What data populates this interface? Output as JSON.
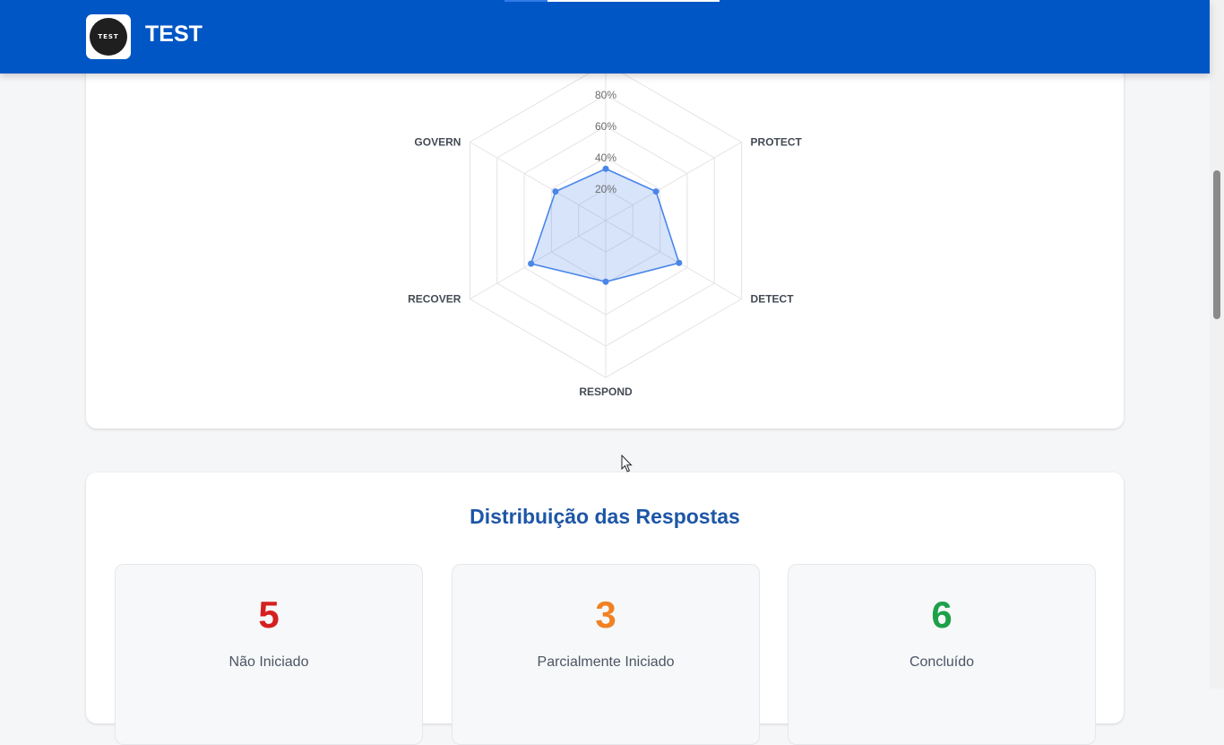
{
  "header": {
    "logo_text": "TEST",
    "title": "TEST",
    "background_color": "#0056c5"
  },
  "radar_chart": {
    "chart_data": {
      "type": "radar",
      "axes": [
        "GOVERN",
        "PROTECT",
        "DETECT",
        "RESPOND",
        "RECOVER"
      ],
      "series": [
        {
          "values": [
            33,
            37,
            54,
            39,
            55,
            37
          ]
        }
      ],
      "axis_order_clockwise_from_top": [
        "(unlabeled top)",
        "PROTECT",
        "DETECT",
        "RESPOND",
        "RECOVER",
        "GOVERN"
      ],
      "tick_labels": [
        "20%",
        "40%",
        "60%",
        "80%"
      ],
      "rmax": 100,
      "line_color": "#4a86e8",
      "fill_color": "rgba(74,134,232,0.22)",
      "grid": true
    }
  },
  "distribution": {
    "title": "Distribuição das Respostas",
    "stats": [
      {
        "value": "5",
        "label": "Não Iniciado",
        "color": "#d42020"
      },
      {
        "value": "3",
        "label": "Parcialmente Iniciado",
        "color": "#f08224"
      },
      {
        "value": "6",
        "label": "Concluído",
        "color": "#1ea04a"
      }
    ]
  }
}
